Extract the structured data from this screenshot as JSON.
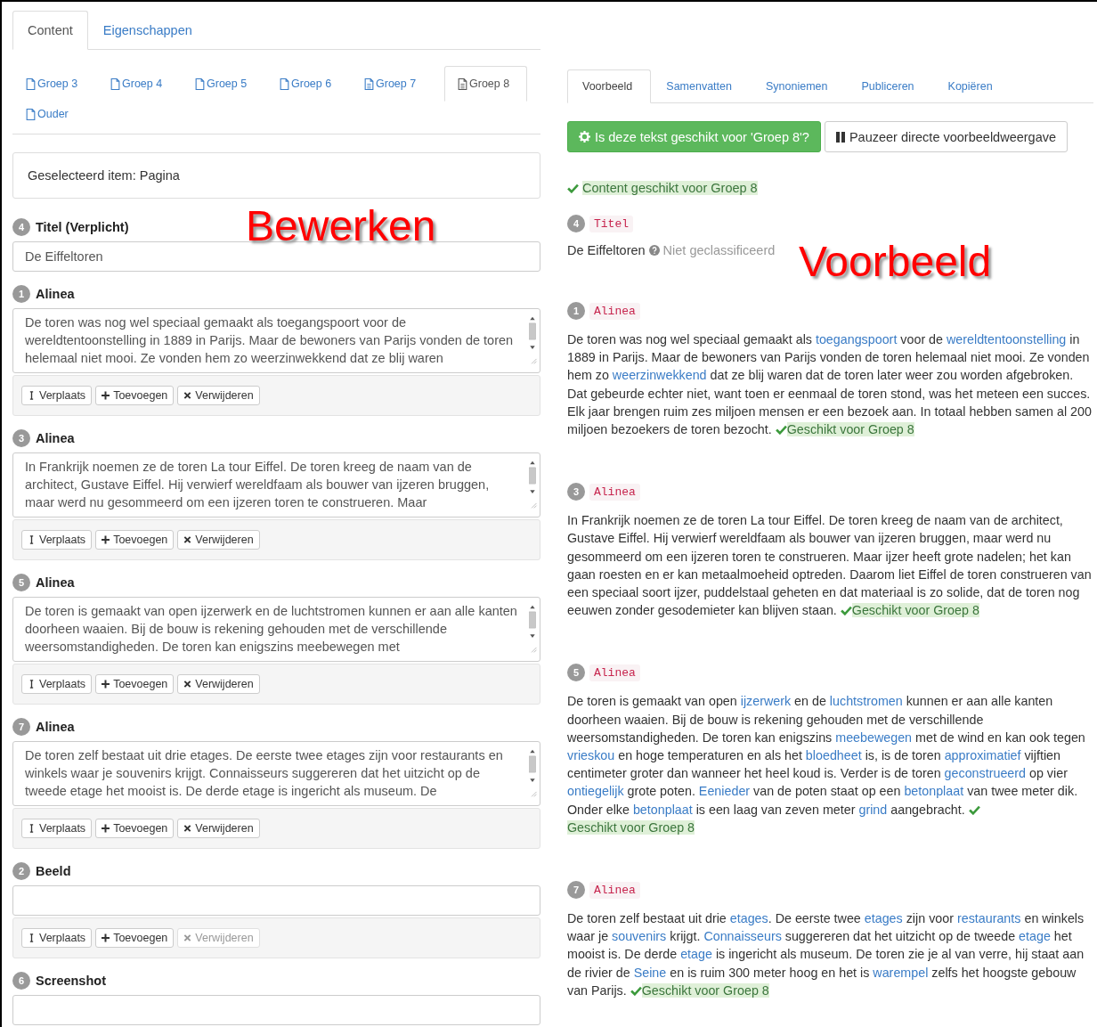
{
  "editor": {
    "tabs": [
      {
        "label": "Content",
        "selected": true
      },
      {
        "label": "Eigenschappen",
        "selected": false
      }
    ],
    "group_tabs": [
      {
        "label": "Groep 3",
        "kind": "plain",
        "selected": false
      },
      {
        "label": "Groep 4",
        "kind": "plain",
        "selected": false
      },
      {
        "label": "Groep 5",
        "kind": "plain",
        "selected": false
      },
      {
        "label": "Groep 6",
        "kind": "plain",
        "selected": false
      },
      {
        "label": "Groep 7",
        "kind": "lines",
        "selected": false
      },
      {
        "label": "Groep 8",
        "kind": "lines",
        "selected": true
      },
      {
        "label": "Ouder",
        "kind": "plain",
        "selected": false
      }
    ],
    "selected_item": "Geselecteerd item: Pagina",
    "overlay_label": "Bewerken",
    "sections": [
      {
        "number": "4",
        "label": "Titel (Verplicht)",
        "kind": "input",
        "value": "De Eiffeltoren"
      },
      {
        "number": "1",
        "label": "Alinea",
        "kind": "textarea",
        "value": "De toren was nog wel speciaal gemaakt als toegangspoort voor de wereldtentoonstelling in 1889 in Parijs. Maar de bewoners van Parijs vonden de toren helemaal niet mooi. Ze vonden hem zo weerzinwekkend dat ze blij waren",
        "buttons": [
          {
            "label": "Verplaats",
            "kind": "move",
            "disabled": false
          },
          {
            "label": "Toevoegen",
            "kind": "add",
            "disabled": false
          },
          {
            "label": "Verwijderen",
            "kind": "remove",
            "disabled": false
          }
        ]
      },
      {
        "number": "3",
        "label": "Alinea",
        "kind": "textarea",
        "value": "In Frankrijk noemen ze de toren La tour Eiffel. De toren kreeg de naam van de architect, Gustave Eiffel. Hij verwierf wereldfaam als bouwer van ijzeren bruggen, maar werd nu gesommeerd om een ijzeren toren te construeren. Maar",
        "buttons": [
          {
            "label": "Verplaats",
            "kind": "move",
            "disabled": false
          },
          {
            "label": "Toevoegen",
            "kind": "add",
            "disabled": false
          },
          {
            "label": "Verwijderen",
            "kind": "remove",
            "disabled": false
          }
        ]
      },
      {
        "number": "5",
        "label": "Alinea",
        "kind": "textarea",
        "value": "De toren is gemaakt van open ijzerwerk en de luchtstromen kunnen er aan alle kanten doorheen waaien. Bij de bouw is rekening gehouden met de verschillende weersomstandigheden. De toren kan enigszins meebewegen met",
        "buttons": [
          {
            "label": "Verplaats",
            "kind": "move",
            "disabled": false
          },
          {
            "label": "Toevoegen",
            "kind": "add",
            "disabled": false
          },
          {
            "label": "Verwijderen",
            "kind": "remove",
            "disabled": false
          }
        ]
      },
      {
        "number": "7",
        "label": "Alinea",
        "kind": "textarea",
        "value": "De toren zelf bestaat uit drie etages. De eerste twee etages zijn voor restaurants en winkels waar je souvenirs krijgt. Connaisseurs suggereren dat het uitzicht op de tweede etage het mooist is. De derde etage is ingericht als museum. De",
        "buttons": [
          {
            "label": "Verplaats",
            "kind": "move",
            "disabled": false
          },
          {
            "label": "Toevoegen",
            "kind": "add",
            "disabled": false
          },
          {
            "label": "Verwijderen",
            "kind": "remove",
            "disabled": false
          }
        ]
      },
      {
        "number": "2",
        "label": "Beeld",
        "kind": "input",
        "buttons": [
          {
            "label": "Verplaats",
            "kind": "move",
            "disabled": false
          },
          {
            "label": "Toevoegen",
            "kind": "add",
            "disabled": false
          },
          {
            "label": "Verwijderen",
            "kind": "remove",
            "disabled": true
          }
        ]
      },
      {
        "number": "6",
        "label": "Screenshot",
        "kind": "input"
      }
    ]
  },
  "preview": {
    "tabs": [
      {
        "label": "Voorbeeld",
        "selected": true
      },
      {
        "label": "Samenvatten",
        "selected": false
      },
      {
        "label": "Synoniemen",
        "selected": false
      },
      {
        "label": "Publiceren",
        "selected": false
      },
      {
        "label": "Kopiëren",
        "selected": false
      }
    ],
    "check_button": "Is deze tekst geschikt voor 'Groep 8'?",
    "pause_button": "Pauzeer directe voorbeeldweergave",
    "status": "Content geschikt voor Groep 8",
    "overlay_label": "Voorbeeld",
    "title_block": {
      "number": "4",
      "label": "Titel",
      "text": "De Eiffeltoren",
      "classification": "Niet geclassificeerd"
    },
    "paragraphs": [
      {
        "number": "1",
        "label": "Alinea",
        "verdict": "Geschikt voor Groep 8",
        "segments": [
          {
            "text": "De toren was nog wel speciaal gemaakt als ",
            "kind": "plain"
          },
          {
            "text": "toegangspoort",
            "kind": "link"
          },
          {
            "text": " voor de ",
            "kind": "plain"
          },
          {
            "text": "wereldtentoonstelling",
            "kind": "link"
          },
          {
            "text": " in 1889 in Parijs. Maar de bewoners van Parijs vonden de toren helemaal niet mooi. Ze vonden hem zo ",
            "kind": "plain"
          },
          {
            "text": "weerzinwekkend",
            "kind": "link"
          },
          {
            "text": " dat ze blij waren dat de toren later weer zou worden afgebroken. Dat gebeurde echter niet, want toen er eenmaal de toren stond, was het meteen een succes. Elk jaar brengen ruim zes miljoen mensen er een bezoek aan. In totaal hebben samen al 200 miljoen bezoekers de toren bezocht.",
            "kind": "plain"
          }
        ]
      },
      {
        "number": "3",
        "label": "Alinea",
        "verdict": "Geschikt voor Groep 8",
        "segments": [
          {
            "text": "In Frankrijk noemen ze de toren La tour Eiffel. De toren kreeg de naam van de architect, Gustave Eiffel. Hij verwierf wereldfaam als bouwer van ijzeren bruggen, maar werd nu gesommeerd om een ijzeren toren te construeren. Maar ijzer heeft grote nadelen; het kan gaan roesten en er kan metaalmoeheid optreden. Daarom liet Eiffel de toren construeren van een speciaal soort ijzer, puddelstaal geheten en dat materiaal is zo solide, dat de toren nog eeuwen zonder gesodemieter kan blijven staan.",
            "kind": "plain"
          }
        ]
      },
      {
        "number": "5",
        "label": "Alinea",
        "verdict": "Geschikt voor Groep 8",
        "segments": [
          {
            "text": "De toren is gemaakt van open ",
            "kind": "plain"
          },
          {
            "text": "ijzerwerk",
            "kind": "link"
          },
          {
            "text": " en de ",
            "kind": "plain"
          },
          {
            "text": "luchtstromen",
            "kind": "link"
          },
          {
            "text": " kunnen er aan alle kanten doorheen waaien. Bij de bouw is rekening gehouden met de verschillende weersomstandigheden. De toren kan enigszins ",
            "kind": "plain"
          },
          {
            "text": "meebewegen",
            "kind": "link"
          },
          {
            "text": " met de wind en kan ook tegen ",
            "kind": "plain"
          },
          {
            "text": "vrieskou",
            "kind": "link"
          },
          {
            "text": " en hoge temperaturen en als het ",
            "kind": "plain"
          },
          {
            "text": "bloedheet",
            "kind": "link"
          },
          {
            "text": " is, is de toren ",
            "kind": "plain"
          },
          {
            "text": "approximatief",
            "kind": "link"
          },
          {
            "text": " vijftien centimeter groter dan wanneer het heel koud is. Verder is de toren ",
            "kind": "plain"
          },
          {
            "text": "geconstrueerd",
            "kind": "link"
          },
          {
            "text": " op vier ",
            "kind": "plain"
          },
          {
            "text": "ontiegelijk",
            "kind": "link"
          },
          {
            "text": " grote poten. ",
            "kind": "plain"
          },
          {
            "text": "Eenieder",
            "kind": "link"
          },
          {
            "text": " van de poten staat op een ",
            "kind": "plain"
          },
          {
            "text": "betonplaat",
            "kind": "link"
          },
          {
            "text": " van twee meter dik. Onder elke ",
            "kind": "plain"
          },
          {
            "text": "betonplaat",
            "kind": "link"
          },
          {
            "text": " is een laag van zeven meter ",
            "kind": "plain"
          },
          {
            "text": "grind",
            "kind": "link"
          },
          {
            "text": " aangebracht.",
            "kind": "plain"
          }
        ]
      },
      {
        "number": "7",
        "label": "Alinea",
        "verdict": "Geschikt voor Groep 8",
        "segments": [
          {
            "text": "De toren zelf bestaat uit drie ",
            "kind": "plain"
          },
          {
            "text": "etages",
            "kind": "link"
          },
          {
            "text": ". De eerste twee ",
            "kind": "plain"
          },
          {
            "text": "etages",
            "kind": "link"
          },
          {
            "text": " zijn voor ",
            "kind": "plain"
          },
          {
            "text": "restaurants",
            "kind": "link"
          },
          {
            "text": " en winkels waar je ",
            "kind": "plain"
          },
          {
            "text": "souvenirs",
            "kind": "link"
          },
          {
            "text": " krijgt. ",
            "kind": "plain"
          },
          {
            "text": "Connaisseurs",
            "kind": "link"
          },
          {
            "text": " suggereren dat het uitzicht op de tweede ",
            "kind": "plain"
          },
          {
            "text": "etage",
            "kind": "link"
          },
          {
            "text": " het mooist is. De derde ",
            "kind": "plain"
          },
          {
            "text": "etage",
            "kind": "link"
          },
          {
            "text": " is ingericht als museum. De toren zie je al van verre, hij staat aan de rivier de ",
            "kind": "plain"
          },
          {
            "text": "Seine",
            "kind": "link"
          },
          {
            "text": " en is ruim 300 meter hoog en het is ",
            "kind": "plain"
          },
          {
            "text": "warempel",
            "kind": "link"
          },
          {
            "text": " zelfs het hoogste gebouw van Parijs.",
            "kind": "plain"
          }
        ]
      }
    ]
  }
}
